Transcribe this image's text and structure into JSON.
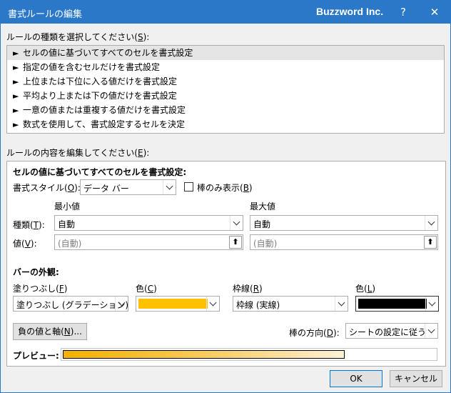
{
  "window": {
    "title": "書式ルールの編集",
    "brand": "Buzzword Inc.",
    "help": "?",
    "close": "✕"
  },
  "rule_type": {
    "label_prefix": "ルールの種類を選択してください(",
    "label_key": "S",
    "label_suffix": "):",
    "items": [
      "セルの値に基づいてすべてのセルを書式設定",
      "指定の値を含むセルだけを書式設定",
      "上位または下位に入る値だけを書式設定",
      "平均より上または下の値だけを書式設定",
      "一意の値または重複する値だけを書式設定",
      "数式を使用して、書式設定するセルを決定"
    ],
    "selected_index": 0,
    "arrow": "►"
  },
  "edit": {
    "label_prefix": "ルールの内容を編集してください(",
    "label_key": "E",
    "label_suffix": "):",
    "section_title": "セルの値に基づいてすべてのセルを書式設定:",
    "format_style_label": "書式スタイル(",
    "format_style_key": "O",
    "format_style_suffix": "):",
    "format_style_value": "データ バー",
    "bar_only_label": "棒のみ表示(",
    "bar_only_key": "B",
    "bar_only_suffix": ")",
    "bar_only_checked": false,
    "min_header": "最小値",
    "max_header": "最大値",
    "type_label": "種類(",
    "type_key": "T",
    "type_suffix": "):",
    "min_type": "自動",
    "max_type": "自動",
    "value_label": "値(",
    "value_key": "V",
    "value_suffix": "):",
    "min_value": "(自動)",
    "max_value": "(自動)",
    "ref_icon": "⬆"
  },
  "appearance": {
    "title": "バーの外観:",
    "fill_label": "塗りつぶし(",
    "fill_key": "F",
    "fill_suffix": ")",
    "fill_value": "塗りつぶし (グラデーション)",
    "color_label": "色(",
    "color_key": "C",
    "color_suffix": ")",
    "fill_color": "#ffc000",
    "border_label": "枠線(",
    "border_key": "R",
    "border_suffix": ")",
    "border_value": "枠線 (実線)",
    "border_color_label": "色(",
    "border_color_key": "L",
    "border_color_suffix": ")",
    "border_color": "#000000",
    "negative_button_prefix": "負の値と軸(",
    "negative_button_key": "N",
    "negative_button_suffix": ")...",
    "direction_label": "棒の方向(",
    "direction_key": "D",
    "direction_suffix": "):",
    "direction_value": "シートの設定に従う",
    "preview_label": "プレビュー:",
    "preview_fill_percent": 75
  },
  "buttons": {
    "ok": "OK",
    "cancel": "キャンセル"
  }
}
